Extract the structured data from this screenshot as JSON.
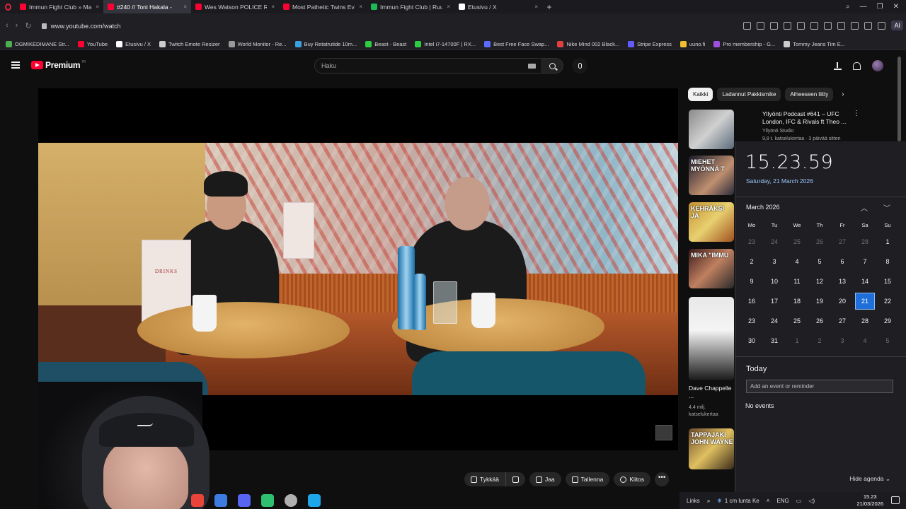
{
  "browser": {
    "tabs": [
      {
        "title": "Immun Fight Club » Mag",
        "color": "#ff0033",
        "active": false
      },
      {
        "title": "#240 // Toni Hakala -",
        "color": "#ff0033",
        "active": true
      },
      {
        "title": "Wes Watson POLICE REPO",
        "color": "#ff0033",
        "active": false
      },
      {
        "title": "Most Pathetic Twins Ever",
        "color": "#ff0033",
        "active": false
      },
      {
        "title": "Immun Fight Club | Ruutu",
        "color": "#1db954",
        "active": false
      },
      {
        "title": "Etusivu / X",
        "color": "#ffffff",
        "active": false
      }
    ],
    "close_glyph": "×",
    "new_tab_glyph": "+",
    "url": "www.youtube.com/watch",
    "ai_label": "AI",
    "bookmarks": [
      {
        "label": "OGMIKEDIMANE Str...",
        "color": "#4caf50"
      },
      {
        "label": "YouTube",
        "color": "#ff0033"
      },
      {
        "label": "Etusivu / X",
        "color": "#ffffff"
      },
      {
        "label": "Twitch Emote Resizer",
        "color": "#cccccc"
      },
      {
        "label": "World Monitor - Re...",
        "color": "#999999"
      },
      {
        "label": "Buy Retatrutide 10m...",
        "color": "#3aa0e0"
      },
      {
        "label": "Beast - Beast",
        "color": "#2ecc40"
      },
      {
        "label": "Intel i7-14700F | RX...",
        "color": "#2ecc40"
      },
      {
        "label": "Best Free Face Swap...",
        "color": "#5a6cff"
      },
      {
        "label": "Nike Mind 002 Black...",
        "color": "#e04040"
      },
      {
        "label": "Stripe Express",
        "color": "#635bff"
      },
      {
        "label": "uuno.fi",
        "color": "#f0c030"
      },
      {
        "label": "Pro membership - G...",
        "color": "#a050e0"
      },
      {
        "label": "Tommy Jeans Tim E...",
        "color": "#cccccc"
      }
    ]
  },
  "youtube": {
    "logo_text": "Premium",
    "logo_sup": "FI",
    "search_placeholder": "Haku",
    "actions": {
      "like": "Tykkää",
      "share": "Jaa",
      "save": "Tallenna",
      "thanks": "Kiitos",
      "more": "•••"
    },
    "menu_card_text": "DRINKS",
    "chips": [
      "Kaikki",
      "Ladannut Pakkismike",
      "Aiheeseen liitty"
    ],
    "chip_next": "›",
    "kebab": "⋮",
    "recommendations": [
      {
        "title": "Yllyönti Podcast #641 – UFC London, IFC & Rivals ft Theo ...",
        "channel": "Yllyönti Studio",
        "meta": "9,8 t. katselukertaa · 3 päivää sitten",
        "thumb_text": ""
      },
      {
        "title": "",
        "channel": "",
        "meta": "",
        "thumb_text": "MIEHET MYÖNNÄ T"
      },
      {
        "title": "",
        "channel": "",
        "meta": "",
        "thumb_text": "KEHRÄKSI JA"
      },
      {
        "title": "",
        "channel": "",
        "meta": "",
        "thumb_text": "MIKA \"IMMU"
      },
      {
        "title": "Dave Chappelle ...",
        "channel": "",
        "meta": "4,4 milj. katselukertaa",
        "thumb_text": ""
      },
      {
        "title": "",
        "channel": "",
        "meta": "",
        "thumb_text": "TAPPAJAKI JOHN WAYNE"
      }
    ]
  },
  "calendar": {
    "time": "15.23.59",
    "date_long": "Saturday, 21 March 2026",
    "month_title": "March 2026",
    "chev_up": "︿",
    "chev_down": "﹀",
    "weekdays": [
      "Mo",
      "Tu",
      "We",
      "Th",
      "Fr",
      "Sa",
      "Su"
    ],
    "weeks": [
      [
        "23",
        "24",
        "25",
        "26",
        "27",
        "28",
        "1"
      ],
      [
        "2",
        "3",
        "4",
        "5",
        "6",
        "7",
        "8"
      ],
      [
        "9",
        "10",
        "11",
        "12",
        "13",
        "14",
        "15"
      ],
      [
        "16",
        "17",
        "18",
        "19",
        "20",
        "21",
        "22"
      ],
      [
        "23",
        "24",
        "25",
        "26",
        "27",
        "28",
        "29"
      ],
      [
        "30",
        "31",
        "1",
        "2",
        "3",
        "4",
        "5"
      ]
    ],
    "today_day": "21",
    "today_label": "Today",
    "event_placeholder": "Add an event or reminder",
    "no_events": "No events",
    "hide_agenda": "Hide agenda"
  },
  "taskbar": {
    "apps": [
      "#e8443a",
      "#3d7be0",
      "#5865f2",
      "#2fbf71",
      "#b0b0b0",
      "#1ea7e8"
    ],
    "links_label": "Links",
    "weather": "1 cm lunta Ke",
    "lang": "ENG",
    "clock_time": "15.23",
    "clock_date": "21/03/2026"
  }
}
